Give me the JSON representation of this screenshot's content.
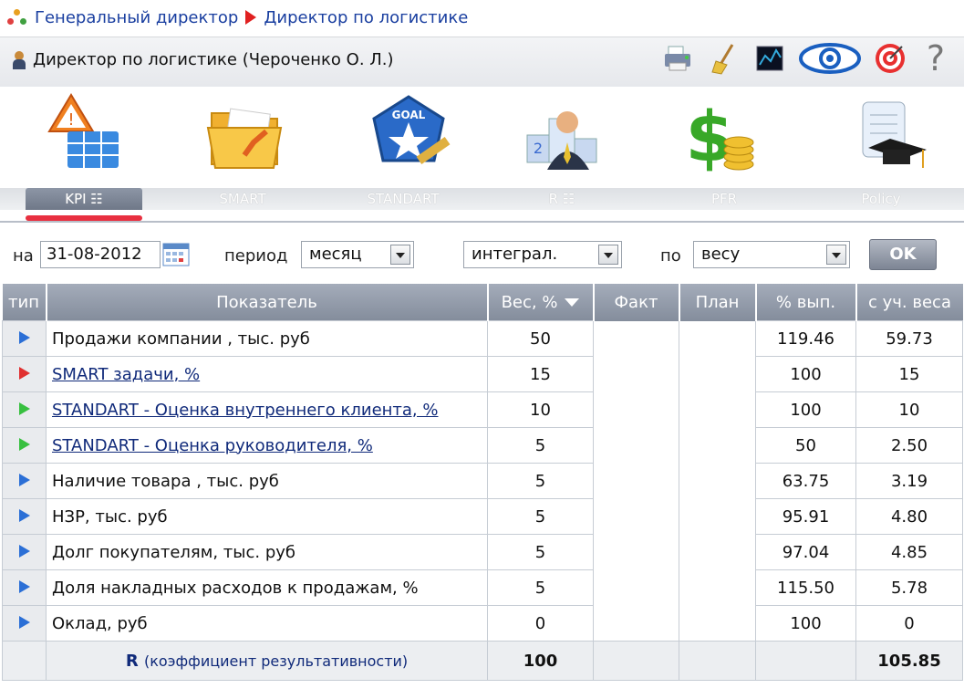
{
  "breadcrumb": {
    "root": "Генеральный директор",
    "current": "Директор по логистике"
  },
  "header": {
    "user_label": "Директор по логистике  (Чероченко О. Л.)"
  },
  "toolbar": {
    "icons": [
      "printer-icon",
      "broom-icon",
      "chart-icon",
      "eye-icon",
      "target-icon",
      "help-icon"
    ],
    "help_glyph": "?"
  },
  "tabs": [
    {
      "label": "KPI  ☷",
      "icon": "kpi-icon",
      "active": true
    },
    {
      "label": "SMART",
      "icon": "folder-icon",
      "active": false
    },
    {
      "label": "STANDART",
      "icon": "goal-icon",
      "active": false
    },
    {
      "label": "R  ☷",
      "icon": "podium-icon",
      "active": false
    },
    {
      "label": "PFR",
      "icon": "dollar-icon",
      "active": false
    },
    {
      "label": "Policy",
      "icon": "graduation-icon",
      "active": false
    }
  ],
  "filters": {
    "date_prefix": "на",
    "date_value": "31-08-2012",
    "period_label": "период",
    "period_value": "месяц",
    "mode_value": "интеграл.",
    "by_label": "по",
    "by_value": "весу",
    "ok_label": "OK"
  },
  "table": {
    "columns": [
      "тип",
      "Показатель",
      "Вес, %",
      "Факт",
      "План",
      "% вып.",
      "с уч. веса"
    ],
    "rows": [
      {
        "type": "blue",
        "name": "Продажи компании , тыс. руб",
        "link": false,
        "weight": "50",
        "fact": "",
        "plan": "",
        "pct": "119.46",
        "weighted": "59.73"
      },
      {
        "type": "red",
        "name": "SMART задачи, %",
        "link": true,
        "weight": "15",
        "fact": "",
        "plan": "",
        "pct": "100",
        "weighted": "15"
      },
      {
        "type": "green",
        "name": "STANDART - Оценка внутреннего клиента, %",
        "link": true,
        "weight": "10",
        "fact": "",
        "plan": "",
        "pct": "100",
        "weighted": "10"
      },
      {
        "type": "green",
        "name": "STANDART - Оценка руководителя, %",
        "link": true,
        "weight": "5",
        "fact": "",
        "plan": "",
        "pct": "50",
        "weighted": "2.50"
      },
      {
        "type": "blue",
        "name": "Наличие товара , тыс. руб",
        "link": false,
        "weight": "5",
        "fact": "",
        "plan": "",
        "pct": "63.75",
        "weighted": "3.19"
      },
      {
        "type": "blue",
        "name": "НЗР, тыс. руб",
        "link": false,
        "weight": "5",
        "fact": "",
        "plan": "",
        "pct": "95.91",
        "weighted": "4.80"
      },
      {
        "type": "blue",
        "name": "Долг покупателям, тыс. руб",
        "link": false,
        "weight": "5",
        "fact": "",
        "plan": "",
        "pct": "97.04",
        "weighted": "4.85"
      },
      {
        "type": "blue",
        "name": "Доля накладных расходов к продажам, %",
        "link": false,
        "weight": "5",
        "fact": "",
        "plan": "",
        "pct": "115.50",
        "weighted": "5.78"
      },
      {
        "type": "blue",
        "name": "Оклад, руб",
        "link": false,
        "weight": "0",
        "fact": "",
        "plan": "",
        "pct": "100",
        "weighted": "0"
      }
    ],
    "total": {
      "label": "R",
      "label_note": "(коэффициент результативности)",
      "weight": "100",
      "weighted": "105.85"
    }
  },
  "colors": {
    "accent_red": "#e83040",
    "header_gray": "#8d96a6",
    "link_blue": "#102a7a"
  }
}
